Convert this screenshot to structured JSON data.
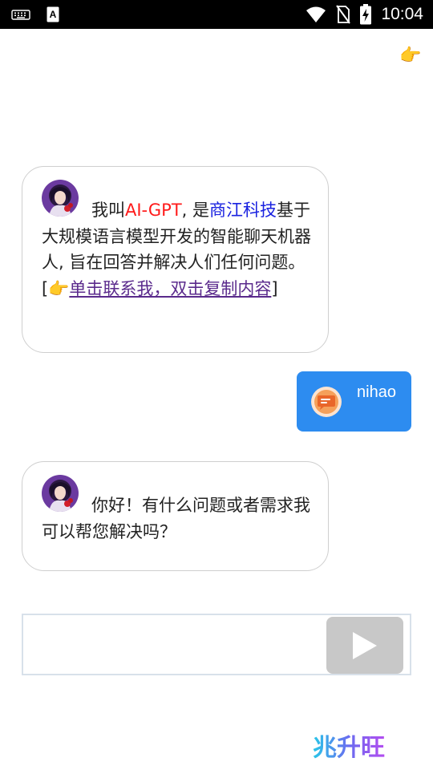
{
  "status_bar": {
    "time": "10:04",
    "icons": [
      "keyboard-icon",
      "font-a-icon",
      "wifi-icon",
      "no-sim-icon",
      "battery-charging-icon"
    ]
  },
  "top_pointer": {
    "glyph": "👉",
    "icon": "pointing-hand-icon"
  },
  "messages": [
    {
      "role": "assistant",
      "intro": "我叫",
      "name": "AI-GPT",
      "comma1": ", 是",
      "company": "商江科技",
      "body": "基于大规模语言模型开发的智能聊天机器人, 旨在回答并解决人们任何问题。[",
      "pointer": "👉",
      "link_text": "单击联系我，双击复制内容",
      "bracket_close": "]",
      "colors": {
        "name": "#ff1a1a",
        "company": "#1a22e0",
        "link": "#5a2a8c"
      }
    },
    {
      "role": "user",
      "text": "nihao"
    },
    {
      "role": "assistant",
      "text": "你好！有什么问题或者需求我可以帮您解决吗？"
    }
  ],
  "composer": {
    "input_value": "",
    "send_icon": "play-triangle-icon"
  },
  "brand": {
    "text": "兆升旺"
  },
  "colors": {
    "user_bubble": "#2d8cf0",
    "send_button": "#c8c8c8",
    "bubble_border": "#cfcfcf",
    "input_border": "#d8e1ea"
  }
}
